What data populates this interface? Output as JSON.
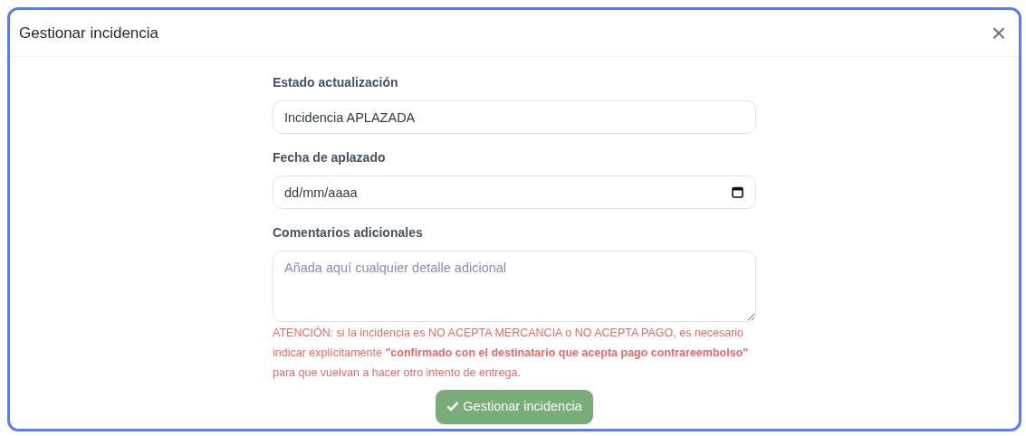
{
  "modal": {
    "title": "Gestionar incidencia",
    "close": "×"
  },
  "form": {
    "status": {
      "label": "Estado actualización",
      "value": "Incidencia APLAZADA"
    },
    "date": {
      "label": "Fecha de aplazado",
      "placeholder": "dd/mm/aaaa"
    },
    "comments": {
      "label": "Comentarios adicionales",
      "placeholder": "Añada aquí cualquier detalle adicional"
    },
    "warning": "ATENCIÓN: si la incidencia es NO ACEPTA MERCANCIA o NO ACEPTA PAGO, es necesario indicar explícitamente **\"confirmado con el destinatario que acepta pago contrareembolso\"** para que vuelvan a hacer otro intento de entrega."
  },
  "submit_button": {
    "label": "Gestionar incidencia"
  }
}
